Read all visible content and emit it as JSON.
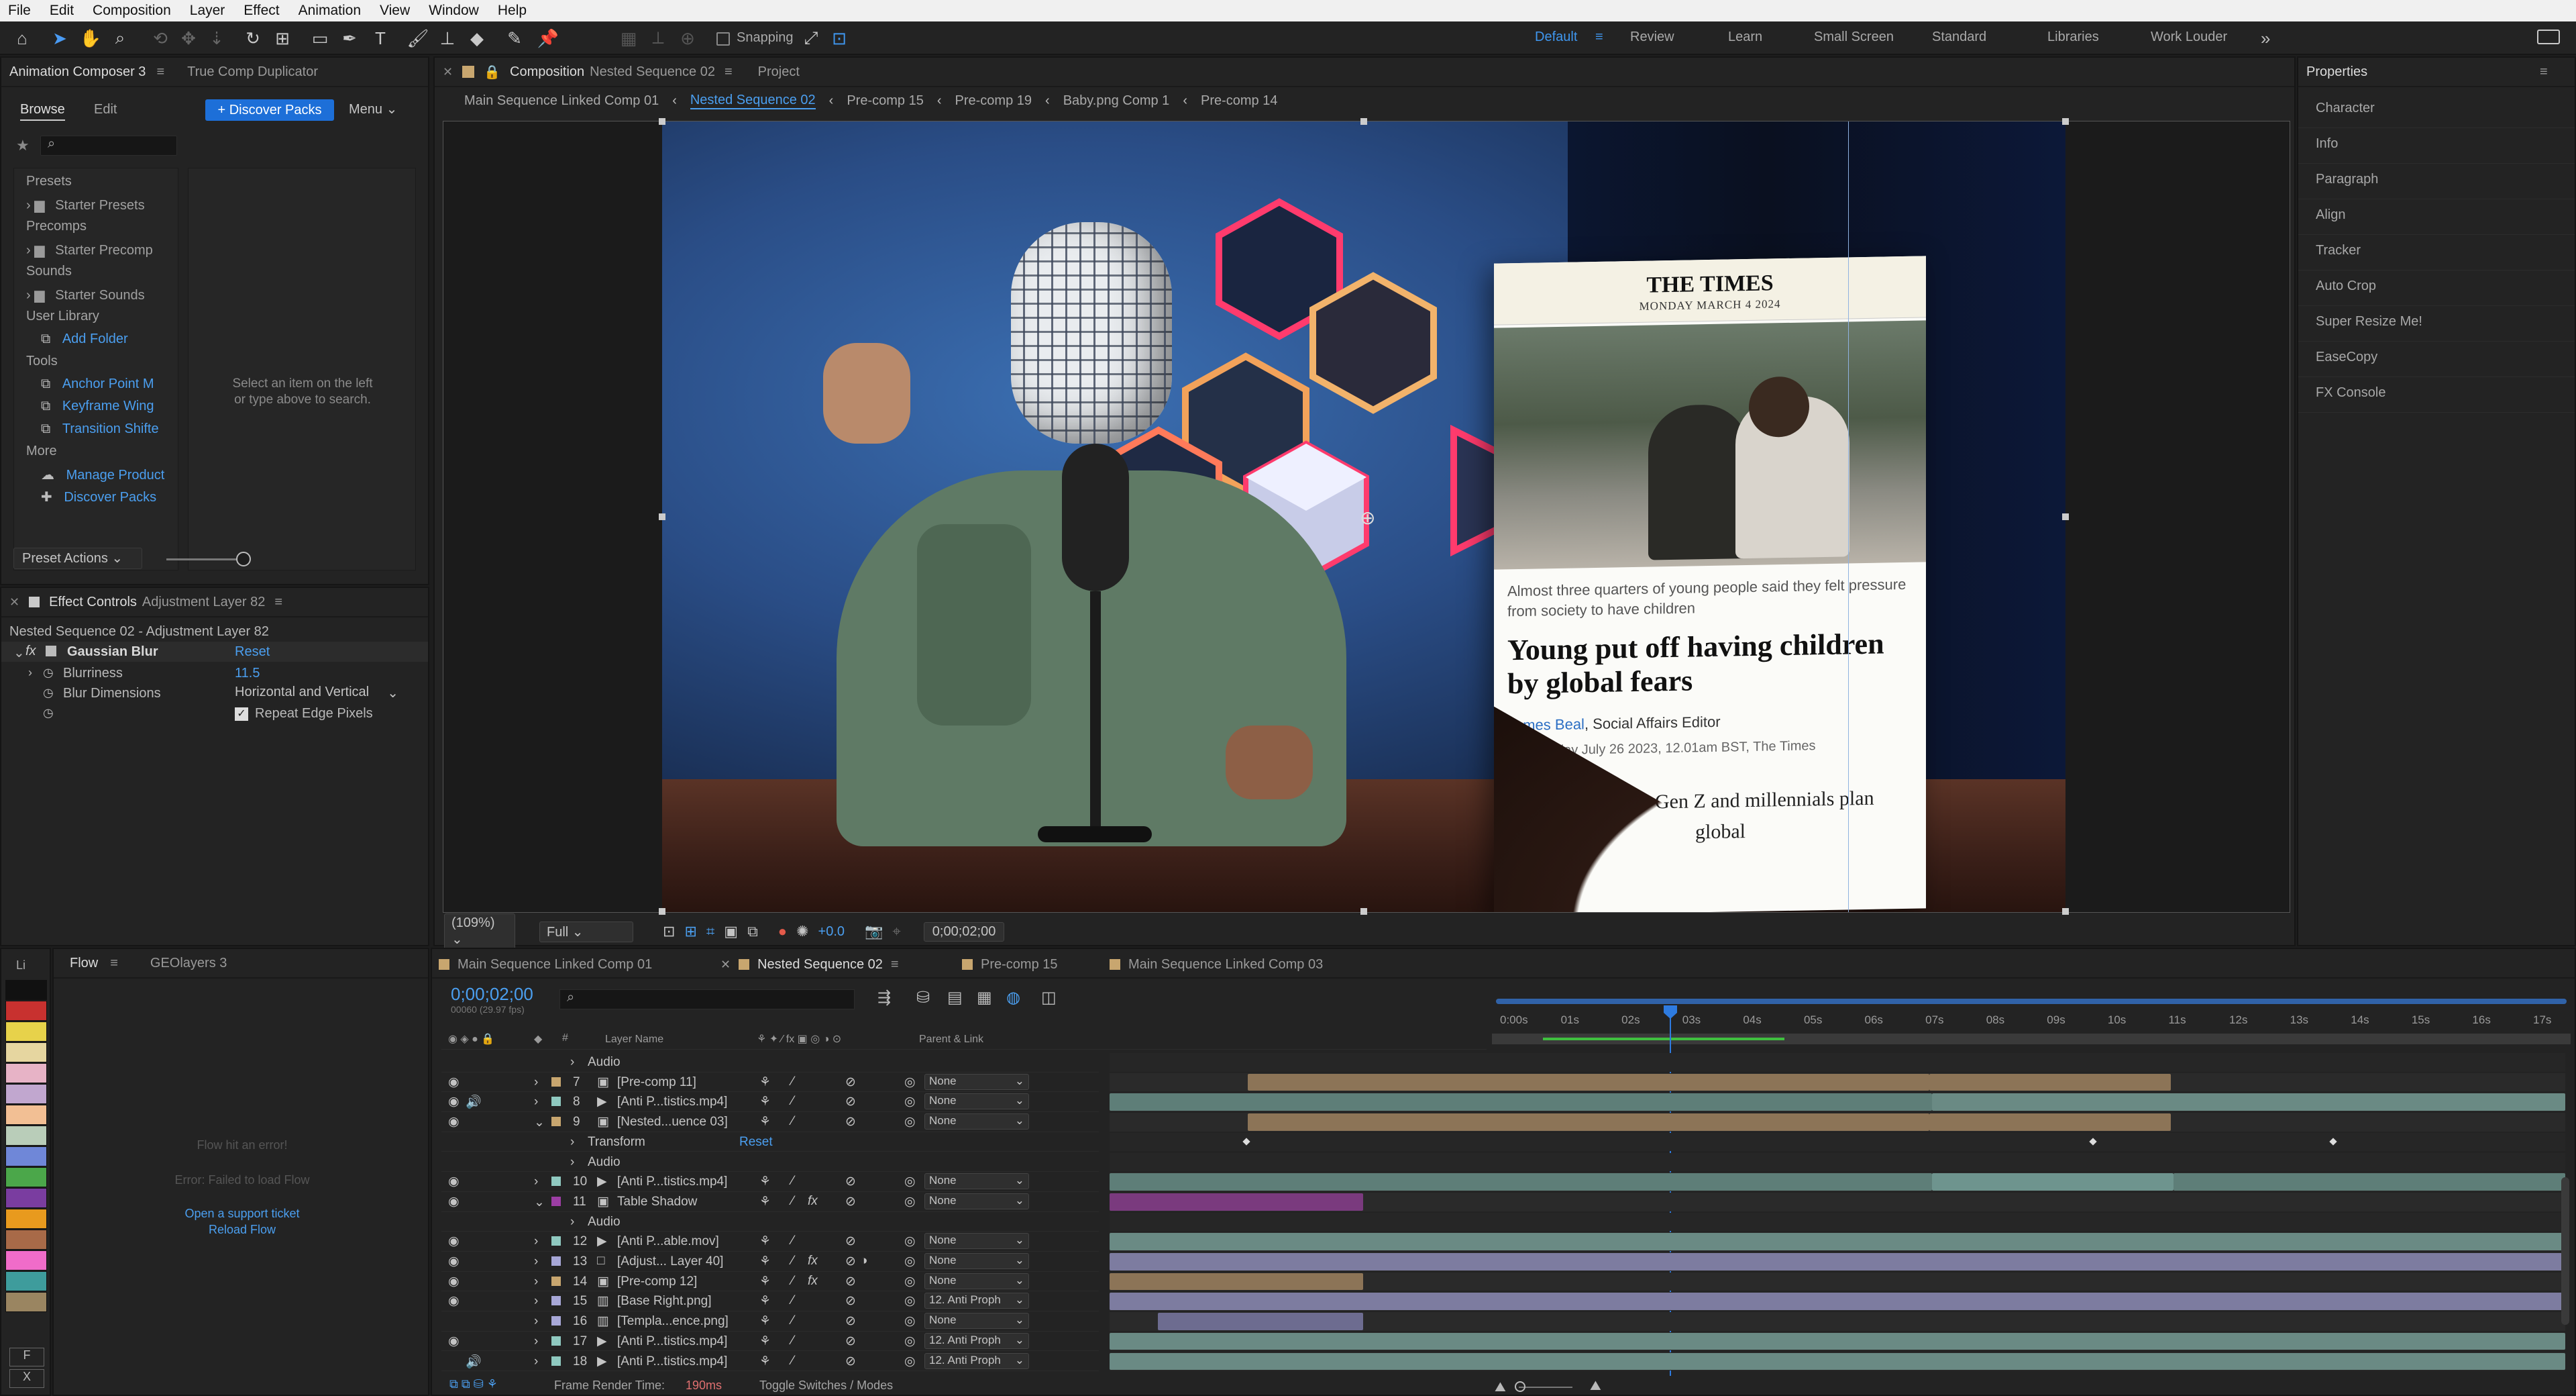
{
  "menu": [
    "File",
    "Edit",
    "Composition",
    "Layer",
    "Effect",
    "Animation",
    "View",
    "Window",
    "Help"
  ],
  "toolbar": {
    "snapping_label": "Snapping",
    "workspaces": [
      {
        "label": "Default",
        "active": true
      },
      {
        "label": "Review"
      },
      {
        "label": "Learn"
      },
      {
        "label": "Small Screen"
      },
      {
        "label": "Standard"
      },
      {
        "label": "Libraries"
      },
      {
        "label": "Work Louder"
      }
    ],
    "more": "»"
  },
  "left_panel": {
    "tabs": [
      "Animation Composer 3",
      "True Comp Duplicator"
    ],
    "subtabs": [
      "Browse",
      "Edit"
    ],
    "discover_button": "+ Discover Packs",
    "menu_label": "Menu",
    "search_placeholder": "",
    "tree": [
      {
        "type": "head",
        "label": "Presets"
      },
      {
        "type": "folder",
        "label": "Starter Presets"
      },
      {
        "type": "head",
        "label": "Precomps"
      },
      {
        "type": "folder",
        "label": "Starter Precomp"
      },
      {
        "type": "head",
        "label": "Sounds"
      },
      {
        "type": "folder",
        "label": "Starter Sounds"
      },
      {
        "type": "head",
        "label": "User Library"
      },
      {
        "type": "link",
        "label": "Add Folder"
      },
      {
        "type": "head",
        "label": "Tools"
      },
      {
        "type": "link",
        "label": "Anchor Point M"
      },
      {
        "type": "link",
        "label": "Keyframe Wing"
      },
      {
        "type": "link",
        "label": "Transition Shifte"
      },
      {
        "type": "head",
        "label": "More"
      },
      {
        "type": "link",
        "label": "Manage Product"
      },
      {
        "type": "link",
        "label": "Discover Packs"
      }
    ],
    "empty_hint_1": "Select an item on the left",
    "empty_hint_2": "or type above to search.",
    "preset_actions": "Preset Actions"
  },
  "effect_controls": {
    "tab_label": "Effect Controls",
    "tab_target": "Adjustment Layer 82",
    "path": "Nested Sequence 02 - Adjustment Layer 82",
    "effect_name": "Gaussian Blur",
    "reset": "Reset",
    "blurriness_label": "Blurriness",
    "blurriness_value": "11.5",
    "dimensions_label": "Blur Dimensions",
    "dimensions_value": "Horizontal and Vertical",
    "repeat_label": "Repeat Edge Pixels"
  },
  "composition": {
    "tab_prefix": "Composition",
    "tab_name": "Nested Sequence 02",
    "project_tab": "Project",
    "breadcrumbs": [
      "Main Sequence Linked Comp 01",
      "Nested Sequence 02",
      "Pre-comp 15",
      "Pre-comp 19",
      "Baby.png Comp 1",
      "Pre-comp 14"
    ],
    "zoom": "(109%)",
    "resolution": "Full",
    "exposure": "+0.0",
    "timecode": "0;00;02;00"
  },
  "article": {
    "masthead": "THE TIMES",
    "date": "MONDAY MARCH 4 2024",
    "standfirst": "Almost three quarters of young people said they felt pressure from society to have children",
    "headline": "Young put off having children by global fears",
    "author": "James Beal",
    "author_role": ", Social Affairs Editor",
    "dateline": "Wednesday July 26 2023, 12.01am BST, The Times",
    "body_fragment": "Gen Z and millennials plan",
    "body_fragment_2": "global"
  },
  "properties": {
    "title": "Properties",
    "items": [
      "Character",
      "Info",
      "Paragraph",
      "Align",
      "Tracker",
      "Auto Crop",
      "Super Resize Me!",
      "EaseCopy",
      "FX Console"
    ]
  },
  "flow_panel": {
    "tabs": [
      "Li",
      "Flow",
      "GEOlayers 3"
    ],
    "error_title": "Flow hit an error!",
    "error_detail": "Error: Failed to load Flow",
    "support_link": "Open a support ticket",
    "reload_link": "Reload Flow",
    "swatches": [
      "#111111",
      "#c8312f",
      "#e7d24a",
      "#e6d6a0",
      "#e7b3c6",
      "#c1a7cf",
      "#f2bf94",
      "#b9cdb9",
      "#6f87d8",
      "#4ba74a",
      "#7a3da0",
      "#e89a1e",
      "#a86a48",
      "#f06cc9",
      "#3e9c9c",
      "#9a8561"
    ],
    "bottom_labels": [
      "F",
      "X"
    ]
  },
  "timeline": {
    "tabs": [
      {
        "label": "Main Sequence Linked Comp 01",
        "color": "#c8a66f"
      },
      {
        "label": "Nested Sequence 02",
        "color": "#c8a66f",
        "active": true
      },
      {
        "label": "Pre-comp 15",
        "color": "#c8a66f"
      },
      {
        "label": "Main Sequence Linked Comp 03",
        "color": "#c8a66f"
      }
    ],
    "timecode": "0;00;02;00",
    "timecode_sub": "00060 (29.97 fps)",
    "col_layer_name": "Layer Name",
    "col_parent": "Parent & Link",
    "ruler": [
      "0:00s",
      "01s",
      "02s",
      "03s",
      "04s",
      "05s",
      "06s",
      "07s",
      "08s",
      "09s",
      "10s",
      "11s",
      "12s",
      "13s",
      "14s",
      "15s",
      "16s",
      "17s"
    ],
    "rows": [
      {
        "kind": "sub",
        "label": "Audio"
      },
      {
        "kind": "layer",
        "num": "7",
        "name": "[Pre-comp 11]",
        "color": "#c8a66f",
        "icon": "comp",
        "parent": "None",
        "eye": true
      },
      {
        "kind": "layer",
        "num": "8",
        "name": "[Anti P...tistics.mp4]",
        "color": "#8fc9c0",
        "icon": "video",
        "parent": "None",
        "eye": true,
        "audio": true
      },
      {
        "kind": "layer",
        "num": "9",
        "name": "[Nested...uence 03]",
        "color": "#c8a66f",
        "icon": "comp",
        "parent": "None",
        "eye": true,
        "open": true
      },
      {
        "kind": "sub",
        "label": "Transform",
        "reset": "Reset"
      },
      {
        "kind": "sub",
        "label": "Audio"
      },
      {
        "kind": "layer",
        "num": "10",
        "name": "[Anti P...tistics.mp4]",
        "color": "#8fc9c0",
        "icon": "video",
        "parent": "None",
        "eye": true
      },
      {
        "kind": "layer",
        "num": "11",
        "name": "Table Shadow",
        "color": "#9c3ea4",
        "icon": "comp",
        "parent": "None",
        "eye": true,
        "fx": true,
        "open": true
      },
      {
        "kind": "sub",
        "label": "Audio"
      },
      {
        "kind": "layer",
        "num": "12",
        "name": "[Anti P...able.mov]",
        "color": "#8fc9c0",
        "icon": "video",
        "parent": "None",
        "eye": true
      },
      {
        "kind": "layer",
        "num": "13",
        "name": "[Adjust... Layer 40]",
        "color": "#a7a7d7",
        "icon": "solid",
        "parent": "None",
        "eye": true,
        "fx": true
      },
      {
        "kind": "layer",
        "num": "14",
        "name": "[Pre-comp 12]",
        "color": "#c8a66f",
        "icon": "comp",
        "parent": "None",
        "eye": true,
        "fx": true
      },
      {
        "kind": "layer",
        "num": "15",
        "name": "[Base Right.png]",
        "color": "#a7a7d7",
        "icon": "image",
        "parent": "12. Anti Proph",
        "eye": true
      },
      {
        "kind": "layer",
        "num": "16",
        "name": "[Templa...ence.png]",
        "color": "#a7a7d7",
        "icon": "image",
        "parent": "None",
        "eye": false
      },
      {
        "kind": "layer",
        "num": "17",
        "name": "[Anti P...tistics.mp4]",
        "color": "#8fc9c0",
        "icon": "video",
        "parent": "12. Anti Proph",
        "eye": true
      },
      {
        "kind": "layer",
        "num": "18",
        "name": "[Anti P...tistics.mp4]",
        "color": "#8fc9c0",
        "icon": "video",
        "parent": "12. Anti Proph",
        "eye": false,
        "audio": true
      }
    ],
    "footer_render_label": "Frame Render Time:",
    "footer_render_value": "190ms",
    "footer_toggle": "Toggle Switches / Modes"
  }
}
